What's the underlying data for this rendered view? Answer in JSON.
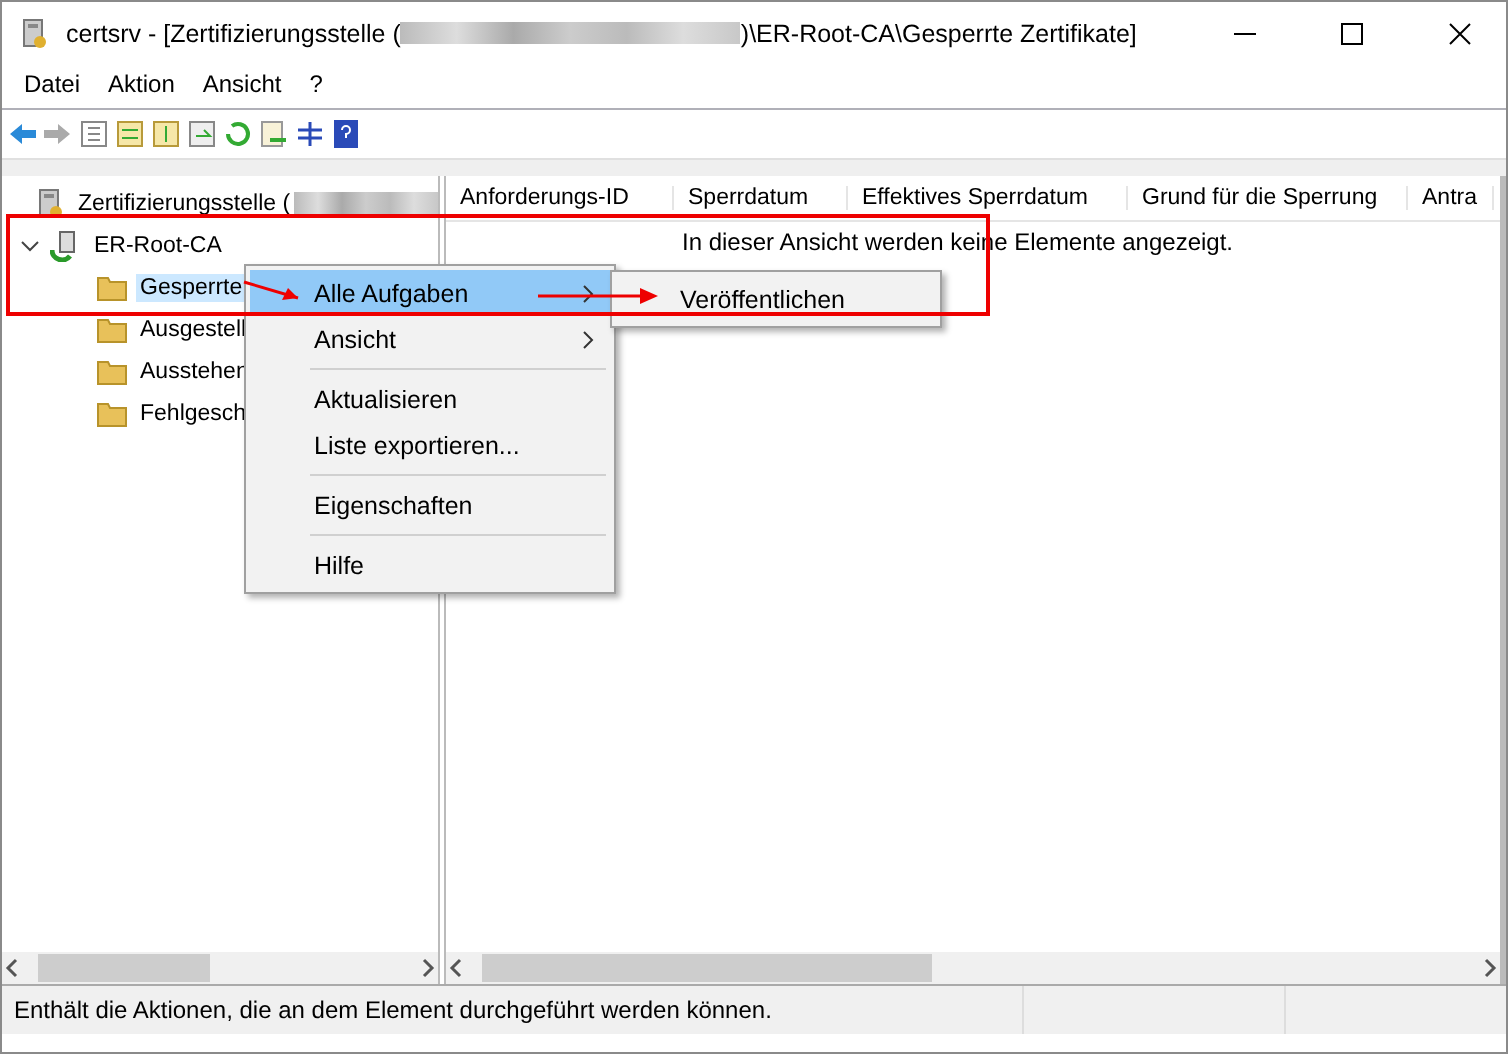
{
  "window": {
    "title_prefix": "certsrv - [Zertifizierungsstelle (",
    "title_suffix": ")\\ER-Root-CA\\Gesperrte Zertifikate]"
  },
  "menu_bar": [
    "Datei",
    "Aktion",
    "Ansicht",
    "?"
  ],
  "tree": [
    {
      "label": "Zertifizierungsstelle (",
      "kind": "server",
      "selected": false,
      "children": [
        {
          "label": "ER-Root-CA",
          "kind": "ca",
          "selected": false,
          "expanded": true,
          "children": [
            {
              "label": "Gesperrte",
              "kind": "folder",
              "selected": true
            },
            {
              "label": "Ausgestell",
              "kind": "folder",
              "selected": false
            },
            {
              "label": "Ausstehen",
              "kind": "folder",
              "selected": false
            },
            {
              "label": "Fehlgesch",
              "kind": "folder",
              "selected": false
            }
          ]
        }
      ]
    }
  ],
  "columns": [
    "Anforderungs-ID",
    "Sperrdatum",
    "Effektives Sperrdatum",
    "Grund für die Sperrung",
    "Antra"
  ],
  "empty_message": "In dieser Ansicht werden keine Elemente angezeigt.",
  "context_menu": [
    {
      "kind": "item",
      "label": "Alle Aufgaben",
      "submenu": true,
      "selected": true
    },
    {
      "kind": "item",
      "label": "Ansicht",
      "submenu": true,
      "selected": false
    },
    {
      "kind": "separator"
    },
    {
      "kind": "item",
      "label": "Aktualisieren",
      "submenu": false,
      "selected": false
    },
    {
      "kind": "item",
      "label": "Liste exportieren...",
      "submenu": false,
      "selected": false
    },
    {
      "kind": "separator"
    },
    {
      "kind": "item",
      "label": "Eigenschaften",
      "submenu": false,
      "selected": false
    },
    {
      "kind": "separator"
    },
    {
      "kind": "item",
      "label": "Hilfe",
      "submenu": false,
      "selected": false
    }
  ],
  "submenu": [
    {
      "label": "Veröffentlichen"
    }
  ],
  "status_bar": "Enthält die Aktionen, die an dem Element durchgeführt werden können."
}
